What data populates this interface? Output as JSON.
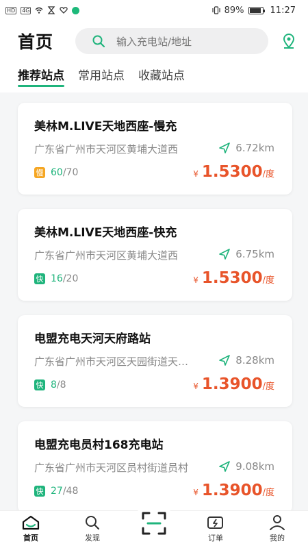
{
  "status_bar": {
    "network_tags": [
      "HD",
      "4G"
    ],
    "battery": "89%",
    "battery_level": 0.89,
    "time": "11:27"
  },
  "header": {
    "title": "首页",
    "search_placeholder": "输入充电站/地址",
    "icons": {
      "search": "search-icon",
      "location": "location-pin-icon"
    }
  },
  "tabs": [
    {
      "label": "推荐站点",
      "active": true
    },
    {
      "label": "常用站点",
      "active": false
    },
    {
      "label": "收藏站点",
      "active": false
    }
  ],
  "stations": [
    {
      "name": "美林M.LIVE天地西座-慢充",
      "address": "广东省广州市天河区黄埔大道西",
      "distance": "6.72km",
      "type": "慢",
      "type_color": "#f5a623",
      "available": "60",
      "total": "/70",
      "currency": "¥",
      "price": "1.5300",
      "unit": "/度"
    },
    {
      "name": "美林M.LIVE天地西座-快充",
      "address": "广东省广州市天河区黄埔大道西",
      "distance": "6.75km",
      "type": "快",
      "type_color": "#1fb47c",
      "available": "16",
      "total": "/20",
      "currency": "¥",
      "price": "1.5300",
      "unit": "/度"
    },
    {
      "name": "电盟充电天河天府路站",
      "address": "广东省广州市天河区天园街道天府路",
      "distance": "8.28km",
      "type": "快",
      "type_color": "#1fb47c",
      "available": "8",
      "total": "/8",
      "currency": "¥",
      "price": "1.3900",
      "unit": "/度"
    },
    {
      "name": "电盟充电员村168充电站",
      "address": "广东省广州市天河区员村街道员村",
      "distance": "9.08km",
      "type": "快",
      "type_color": "#1fb47c",
      "available": "27",
      "total": "/48",
      "currency": "¥",
      "price": "1.3900",
      "unit": "/度"
    }
  ],
  "tab_bar": {
    "home": "首页",
    "discover": "发现",
    "scan": "scan-icon",
    "orders": "订单",
    "mine": "我的"
  },
  "colors": {
    "accent": "#1fb47c",
    "price": "#e8542a",
    "slow_badge": "#f5a623"
  }
}
